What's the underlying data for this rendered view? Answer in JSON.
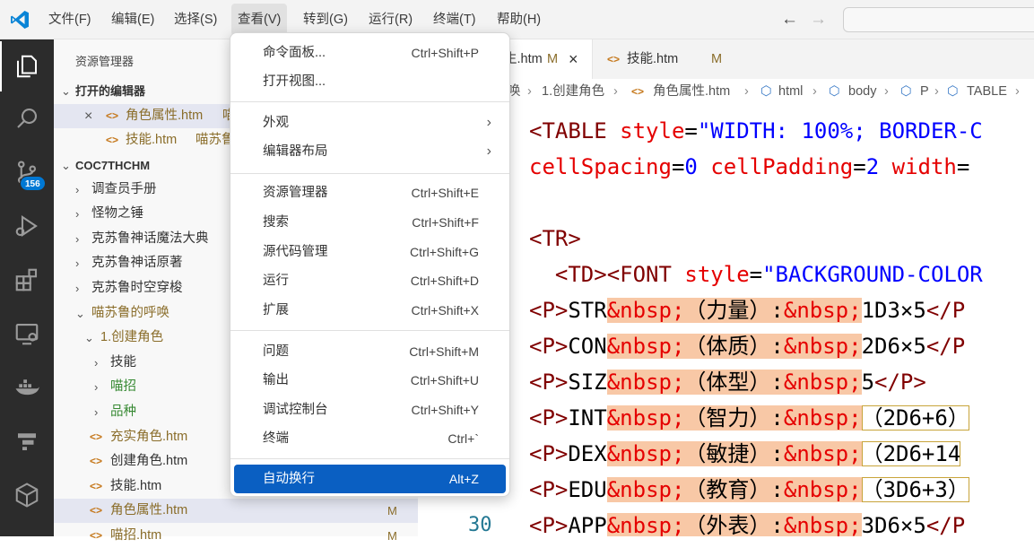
{
  "titlebar": {
    "menus": [
      "文件(F)",
      "编辑(E)",
      "选择(S)",
      "查看(V)",
      "转到(G)",
      "运行(R)",
      "终端(T)",
      "帮助(H)"
    ],
    "back_arrow": "←",
    "forward_arrow": "→"
  },
  "activitybar": {
    "icons": [
      "explorer-icon",
      "search-icon",
      "source-control-icon",
      "run-debug-icon",
      "extensions-icon",
      "remote-explorer-icon",
      "docker-icon",
      "database-icon",
      "box-icon"
    ],
    "badge": "156",
    "accent": "#0078d4"
  },
  "sidebar": {
    "title": "资源管理器",
    "open_editors_header": "打开的编辑器",
    "open_editors": [
      {
        "close": "×",
        "icon": "<>",
        "name": "角色属性.htm",
        "suffix": "喵"
      },
      {
        "icon": "<>",
        "name": "技能.htm",
        "suffix": "喵苏鲁"
      }
    ],
    "workspace_header": "COC7THCHM",
    "tree": [
      {
        "chev": "›",
        "name": "调查员手册"
      },
      {
        "chev": "›",
        "name": "怪物之锤"
      },
      {
        "chev": "›",
        "name": "克苏鲁神话魔法大典"
      },
      {
        "chev": "›",
        "name": "克苏鲁神话原著"
      },
      {
        "chev": "›",
        "name": "克苏鲁时空穿梭"
      },
      {
        "chev": "⌄",
        "name": "喵苏鲁的呼唤"
      },
      {
        "chev": "⌄",
        "name": "1.创建角色"
      },
      {
        "chev": "›",
        "name": "技能"
      },
      {
        "chev": "›",
        "name": "喵招"
      },
      {
        "chev": "›",
        "name": "品种"
      },
      {
        "icon": "<>",
        "name": "充实角色.htm"
      },
      {
        "icon": "<>",
        "name": "创建角色.htm"
      },
      {
        "icon": "<>",
        "name": "技能.htm"
      },
      {
        "icon": "<>",
        "name": "角色属性.htm",
        "mod": "M"
      },
      {
        "icon": "<>",
        "name": "喵招.htm",
        "mod": "M"
      }
    ]
  },
  "tabs": [
    {
      "name": "角色属性.htm",
      "visible_part": "生.htm",
      "mod": "M",
      "close": "×"
    },
    {
      "icon": "<>",
      "name": "技能.htm",
      "mod": "M"
    }
  ],
  "breadcrumb": [
    "唤",
    "1.创建角色",
    "角色属性.htm",
    "html",
    "body",
    "P",
    "TABLE"
  ],
  "view_menu": {
    "items": [
      {
        "label": "命令面板...",
        "shortcut": "Ctrl+Shift+P"
      },
      {
        "label": "打开视图...",
        "shortcut": ""
      },
      {
        "label": "外观",
        "submenu": "›"
      },
      {
        "label": "编辑器布局",
        "submenu": "›"
      },
      {
        "label": "资源管理器",
        "shortcut": "Ctrl+Shift+E"
      },
      {
        "label": "搜索",
        "shortcut": "Ctrl+Shift+F"
      },
      {
        "label": "源代码管理",
        "shortcut": "Ctrl+Shift+G"
      },
      {
        "label": "运行",
        "shortcut": "Ctrl+Shift+D"
      },
      {
        "label": "扩展",
        "shortcut": "Ctrl+Shift+X"
      },
      {
        "label": "问题",
        "shortcut": "Ctrl+Shift+M"
      },
      {
        "label": "输出",
        "shortcut": "Ctrl+Shift+U"
      },
      {
        "label": "调试控制台",
        "shortcut": "Ctrl+Shift+Y"
      },
      {
        "label": "终端",
        "shortcut": "Ctrl+`"
      },
      {
        "label": "自动换行",
        "shortcut": "Alt+Z",
        "selected": true
      }
    ],
    "selected_color": "#0a5fc2"
  },
  "code": {
    "line_number": "30",
    "lines": [
      "<TABLE style=\"WIDTH: 100%; BORDER-C",
      "cellSpacing=0 cellPadding=2 width=",
      "",
      "<TR>",
      "  <TD><FONT style=\"BACKGROUND-COLOR",
      "<P>STR&nbsp;（力量）:&nbsp;1D3×5</P",
      "<P>CON&nbsp;（体质）:&nbsp;2D6×5</P",
      "<P>SIZ&nbsp;（体型）:&nbsp;5</P>",
      "<P>INT&nbsp;（智力）:&nbsp;（2D6+6）",
      "<P>DEX&nbsp;（敏捷）:&nbsp;（2D6+14",
      "<P>EDU&nbsp;（教育）:&nbsp;（3D6+3）",
      "<P>APP&nbsp;（外表）:&nbsp;3D6×5</P"
    ],
    "stat_rows": [
      {
        "key": "STR",
        "name": "（力量）",
        "value": "1D3×5",
        "end": "</P"
      },
      {
        "key": "CON",
        "name": "（体质）",
        "value": "2D6×5",
        "end": "</P"
      },
      {
        "key": "SIZ",
        "name": "（体型）",
        "value": "5",
        "end": "</P>"
      },
      {
        "key": "INT",
        "name": "（智力）",
        "value": "（2D6+6）",
        "end": ""
      },
      {
        "key": "DEX",
        "name": "（敏捷）",
        "value": "（2D6+14",
        "end": ""
      },
      {
        "key": "EDU",
        "name": "（教育）",
        "value": "（3D6+3）",
        "end": ""
      },
      {
        "key": "APP",
        "name": "（外表）",
        "value": "3D6×5",
        "end": "</P"
      }
    ],
    "highlight_color": "#f8c8a6"
  }
}
